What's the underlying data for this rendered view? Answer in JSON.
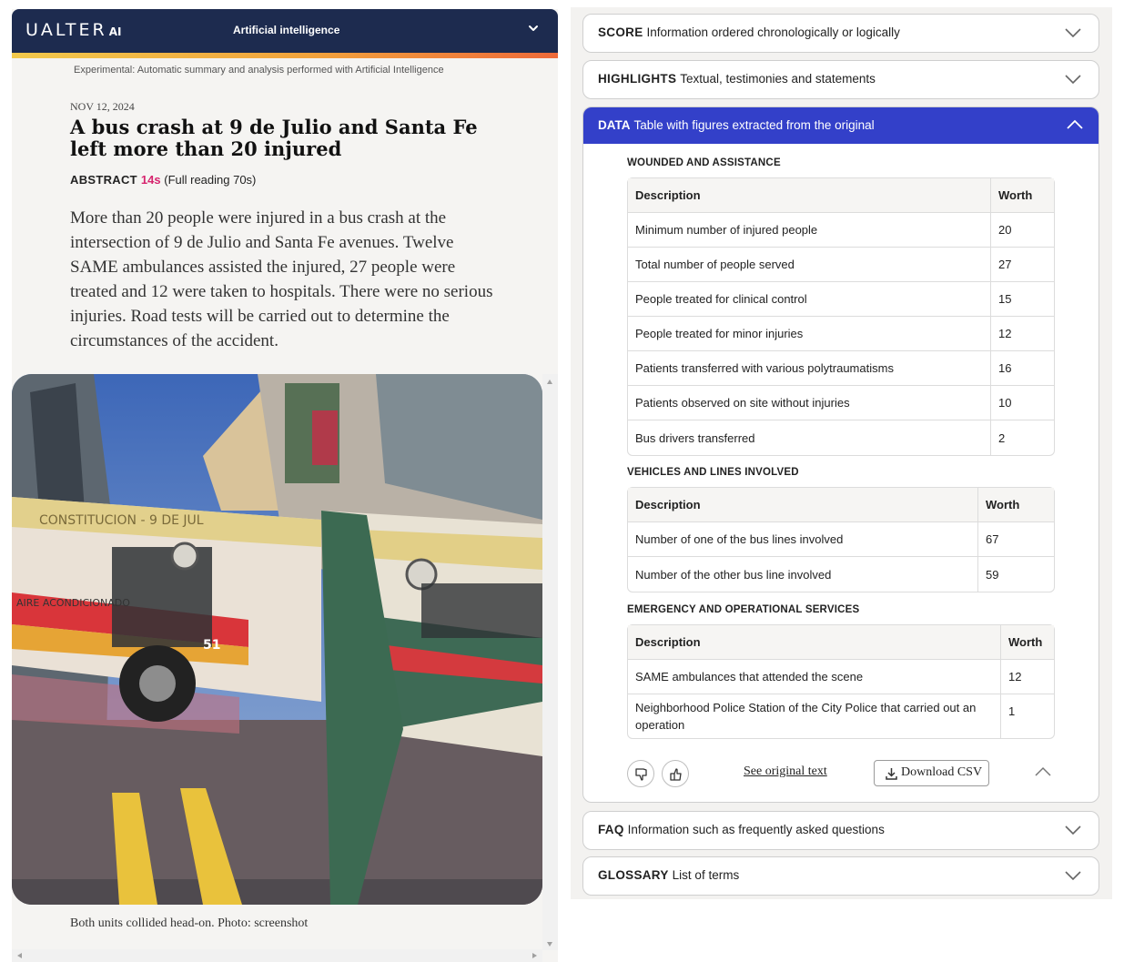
{
  "header": {
    "logo_text": "UALTER",
    "logo_suffix": "AI",
    "section_title": "Artificial intelligence",
    "menu_icon": "chevron-down-icon"
  },
  "experimental_note": "Experimental: Automatic summary and analysis performed with Artificial Intelligence",
  "article": {
    "date": "NOV 12, 2024",
    "title": "A bus crash at 9 de Julio and Santa Fe left more than 20 injured",
    "abstract_label": "ABSTRACT",
    "abstract_seconds": "14s",
    "full_reading": "(Full reading 70s)",
    "summary": "More than 20 people were injured in a bus crash at the intersection of 9 de Julio and Santa Fe avenues. Twelve SAME ambulances assisted the injured, 27 people were treated and 12 were taken to hospitals. There were no serious injuries. Road tests will be carried out to determine the circumstances of the accident.",
    "photo_caption": "Both units collided head-on. Photo: screenshot",
    "photo_sign_text": "CONSTITUCION - 9 DE JUL",
    "photo_bus_text": "AIRE ACONDICIONADO",
    "photo_bus_number": "51"
  },
  "accordion": {
    "score": {
      "label": "SCORE",
      "desc": "Information ordered chronologically or logically"
    },
    "highlights": {
      "label": "HIGHLIGHTS",
      "desc": "Textual, testimonies and statements"
    },
    "data": {
      "label": "DATA",
      "desc": "Table with figures extracted from the original"
    },
    "faq": {
      "label": "FAQ",
      "desc": "Information such as frequently asked questions"
    },
    "glossary": {
      "label": "GLOSSARY",
      "desc": "List of terms"
    }
  },
  "tables": [
    {
      "title": "WOUNDED AND ASSISTANCE",
      "col_desc": "Description",
      "col_value": "Worth",
      "rows": [
        {
          "d": "Minimum number of injured people",
          "v": "20"
        },
        {
          "d": "Total number of people served",
          "v": "27"
        },
        {
          "d": "People treated for clinical control",
          "v": "15"
        },
        {
          "d": "People treated for minor injuries",
          "v": "12"
        },
        {
          "d": "Patients transferred with various polytraumatisms",
          "v": "16"
        },
        {
          "d": "Patients observed on site without injuries",
          "v": "10"
        },
        {
          "d": "Bus drivers transferred",
          "v": "2"
        }
      ]
    },
    {
      "title": "VEHICLES AND LINES INVOLVED",
      "col_desc": "Description",
      "col_value": "Worth",
      "rows": [
        {
          "d": "Number of one of the bus lines involved",
          "v": "67"
        },
        {
          "d": "Number of the other bus line involved",
          "v": "59"
        }
      ]
    },
    {
      "title": "EMERGENCY AND OPERATIONAL SERVICES",
      "col_desc": "Description",
      "col_value": "Worth",
      "rows": [
        {
          "d": "SAME ambulances that attended the scene",
          "v": "12"
        },
        {
          "d": "Neighborhood Police Station of the City Police that carried out an operation",
          "v": "1"
        }
      ]
    }
  ],
  "actions": {
    "see_original": "See original text",
    "download_csv": "Download CSV"
  },
  "colors": {
    "header_bg": "#1d2b4f",
    "accent_blue": "#3340c9",
    "abstract_time": "#d6246e"
  }
}
